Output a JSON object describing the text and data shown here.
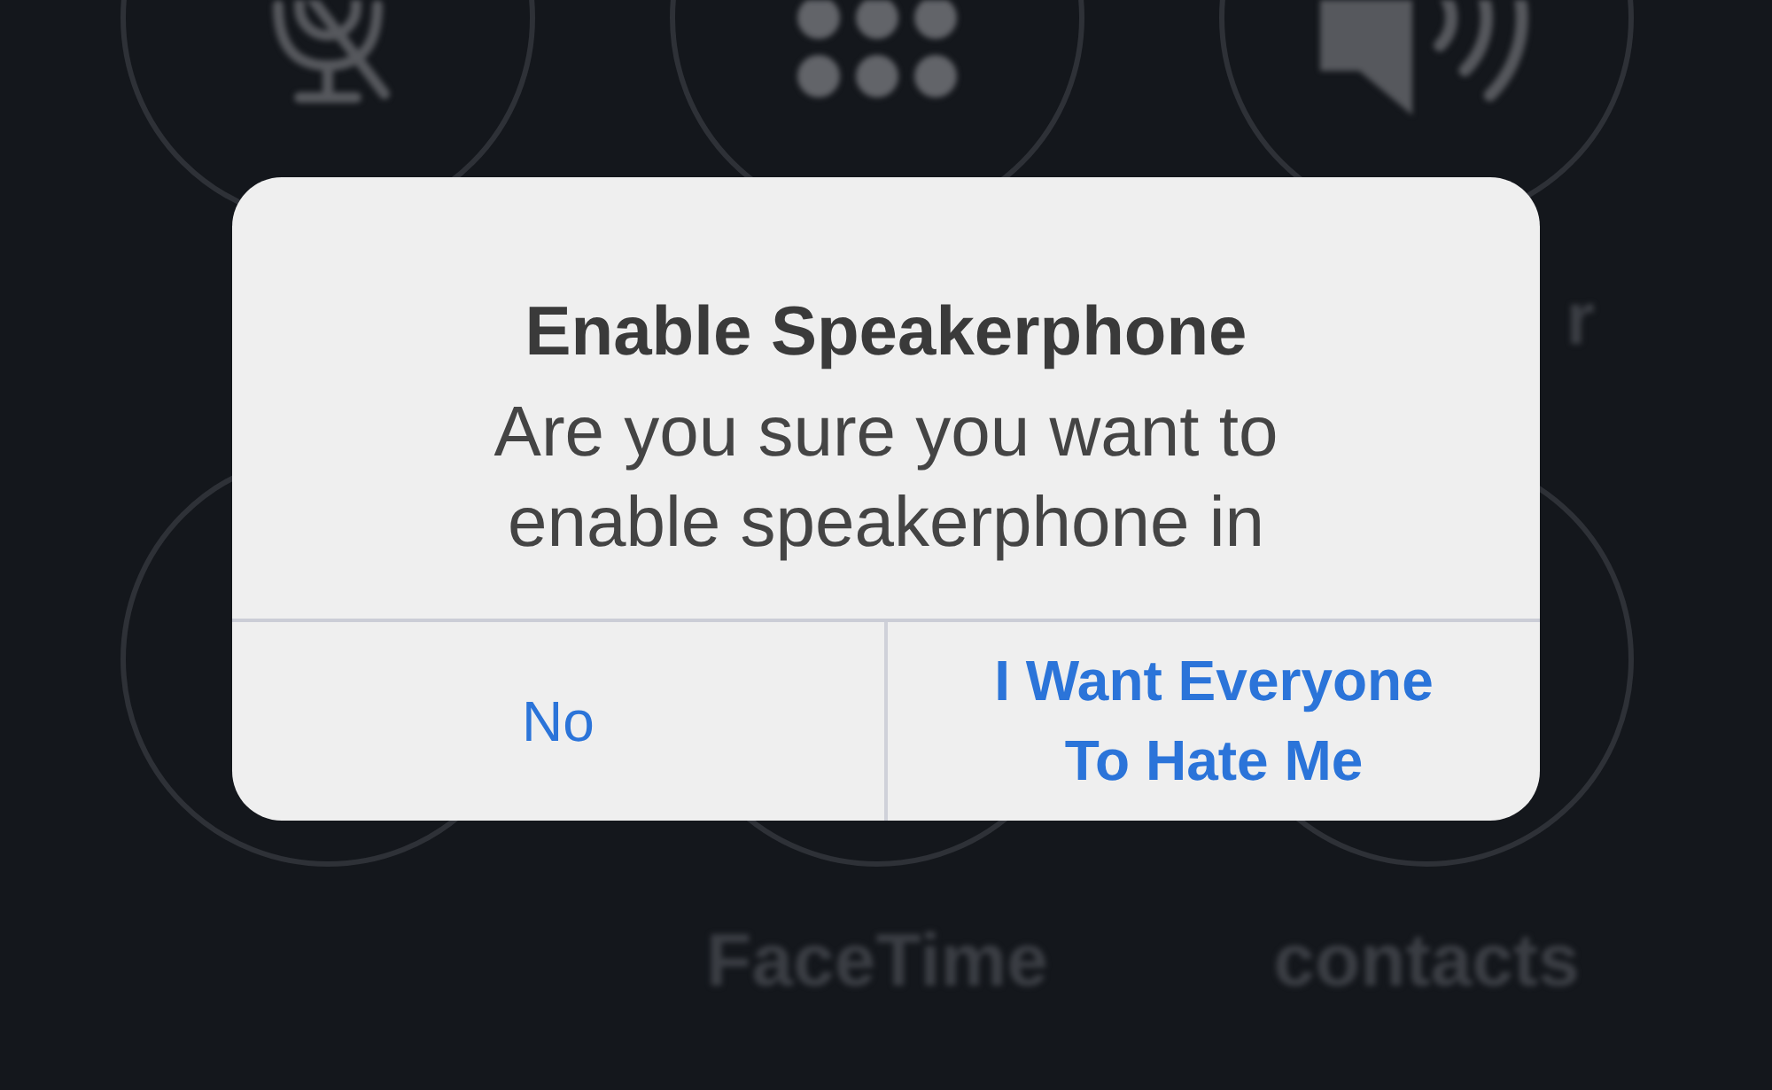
{
  "call_controls": [
    {
      "kind": "microphone"
    },
    {
      "kind": "keypad"
    },
    {
      "kind": "speaker",
      "label": "r"
    },
    {
      "kind": "plain"
    },
    {
      "kind": "plain",
      "label": "FaceTime"
    },
    {
      "kind": "plain",
      "label": "contacts"
    }
  ],
  "alert": {
    "title": "Enable Speakerphone",
    "message": "Are you sure you want to enable speakerphone in",
    "buttons": [
      {
        "label": "No",
        "kind": "cancel"
      },
      {
        "label": "I Want Everyone To Hate Me",
        "kind": "preferred"
      }
    ]
  }
}
